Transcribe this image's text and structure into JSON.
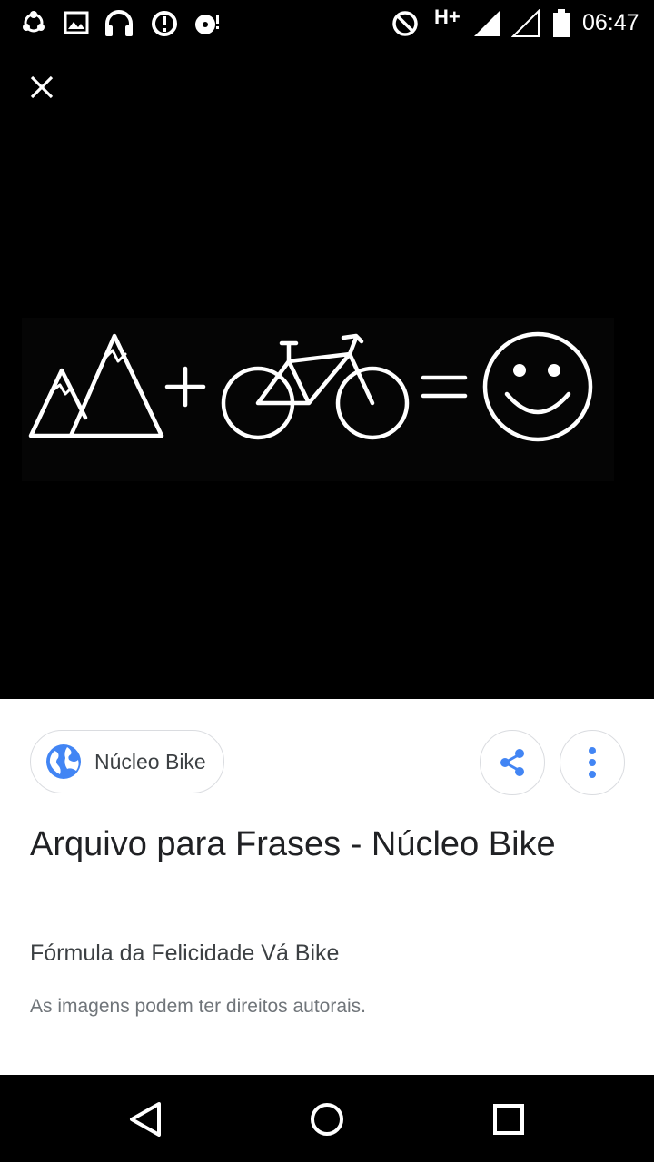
{
  "status_bar": {
    "network_type": "H+",
    "time": "06:47",
    "icons": [
      "sync-icon",
      "image-icon",
      "headphones-icon",
      "alert-icon",
      "media-icon",
      "do-not-disturb-icon",
      "signal-full-icon",
      "signal-empty-icon",
      "battery-icon"
    ]
  },
  "viewer": {
    "close_icon": "close-icon",
    "image_subject": [
      "mountains",
      "plus",
      "bicycle",
      "equals",
      "smiley"
    ]
  },
  "info": {
    "source_label": "Núcleo Bike",
    "title": "Arquivo para Frases - Núcleo Bike",
    "subtitle": "Fórmula da Felicidade Vá Bike",
    "copyright": "As imagens podem ter direitos autorais.",
    "accent_color": "#4285f4"
  },
  "nav_bar": {
    "buttons": [
      "back-icon",
      "home-icon",
      "recents-icon"
    ]
  }
}
